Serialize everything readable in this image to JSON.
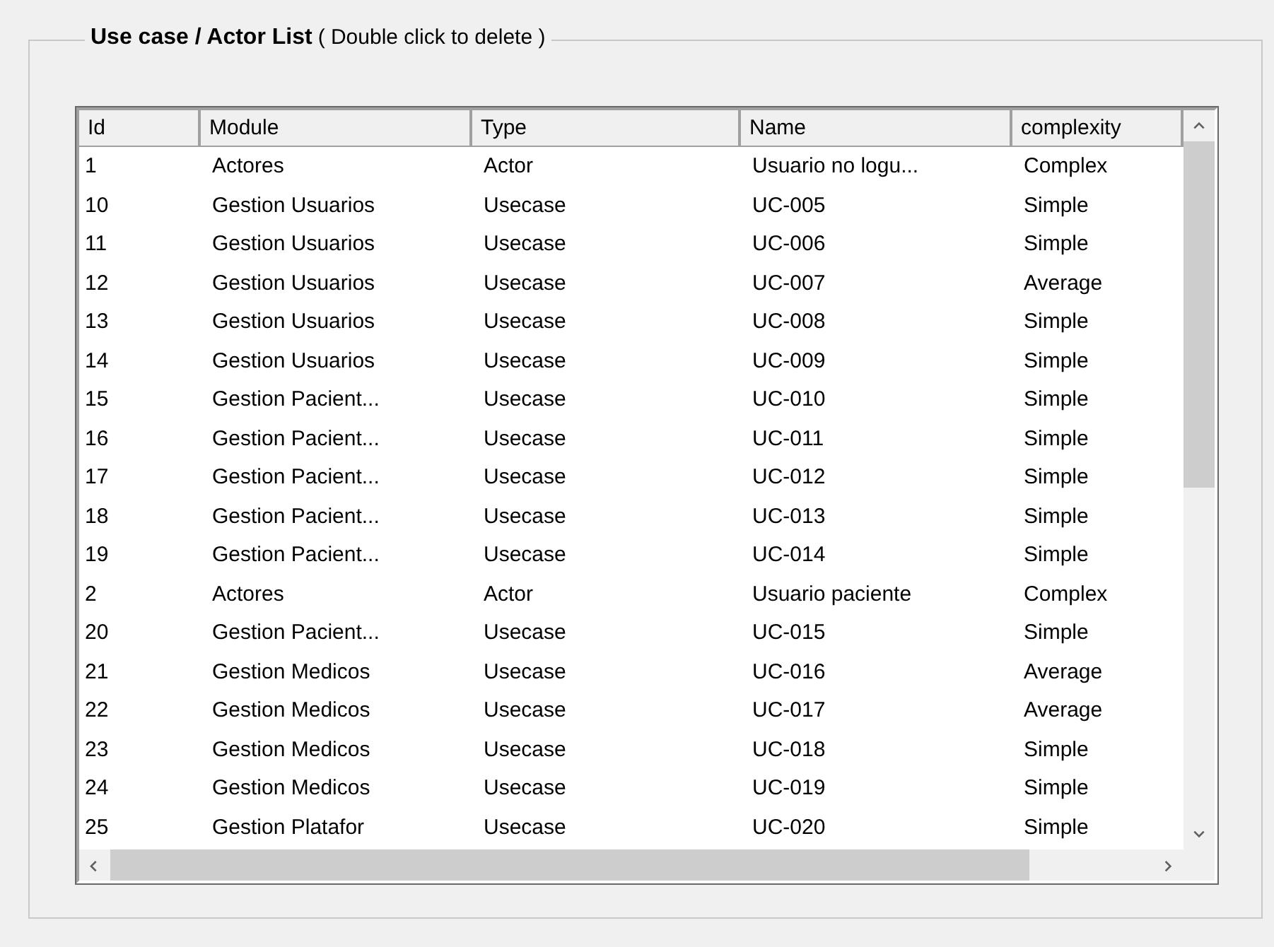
{
  "group": {
    "title": "Use case / Actor List",
    "hint": "( Double click to delete )"
  },
  "table": {
    "columns": [
      "Id",
      "Module",
      "Type",
      "Name",
      "complexity"
    ],
    "rows": [
      [
        "1",
        "Actores",
        "Actor",
        "Usuario no logu...",
        "Complex"
      ],
      [
        "10",
        "Gestion Usuarios",
        "Usecase",
        "UC-005",
        "Simple"
      ],
      [
        "11",
        "Gestion Usuarios",
        "Usecase",
        "UC-006",
        "Simple"
      ],
      [
        "12",
        "Gestion Usuarios",
        "Usecase",
        "UC-007",
        "Average"
      ],
      [
        "13",
        "Gestion Usuarios",
        "Usecase",
        "UC-008",
        "Simple"
      ],
      [
        "14",
        "Gestion Usuarios",
        "Usecase",
        "UC-009",
        "Simple"
      ],
      [
        "15",
        "Gestion Pacient...",
        "Usecase",
        "UC-010",
        "Simple"
      ],
      [
        "16",
        "Gestion Pacient...",
        "Usecase",
        "UC-011",
        "Simple"
      ],
      [
        "17",
        "Gestion Pacient...",
        "Usecase",
        "UC-012",
        "Simple"
      ],
      [
        "18",
        "Gestion Pacient...",
        "Usecase",
        "UC-013",
        "Simple"
      ],
      [
        "19",
        "Gestion Pacient...",
        "Usecase",
        "UC-014",
        "Simple"
      ],
      [
        "2",
        "Actores",
        "Actor",
        "Usuario paciente",
        "Complex"
      ],
      [
        "20",
        "Gestion Pacient...",
        "Usecase",
        "UC-015",
        "Simple"
      ],
      [
        "21",
        "Gestion Medicos",
        "Usecase",
        "UC-016",
        "Average"
      ],
      [
        "22",
        "Gestion Medicos",
        "Usecase",
        "UC-017",
        "Average"
      ],
      [
        "23",
        "Gestion Medicos",
        "Usecase",
        "UC-018",
        "Simple"
      ],
      [
        "24",
        "Gestion Medicos",
        "Usecase",
        "UC-019",
        "Simple"
      ],
      [
        "25",
        "Gestion Platafor",
        "Usecase",
        "UC-020",
        "Simple"
      ]
    ]
  }
}
